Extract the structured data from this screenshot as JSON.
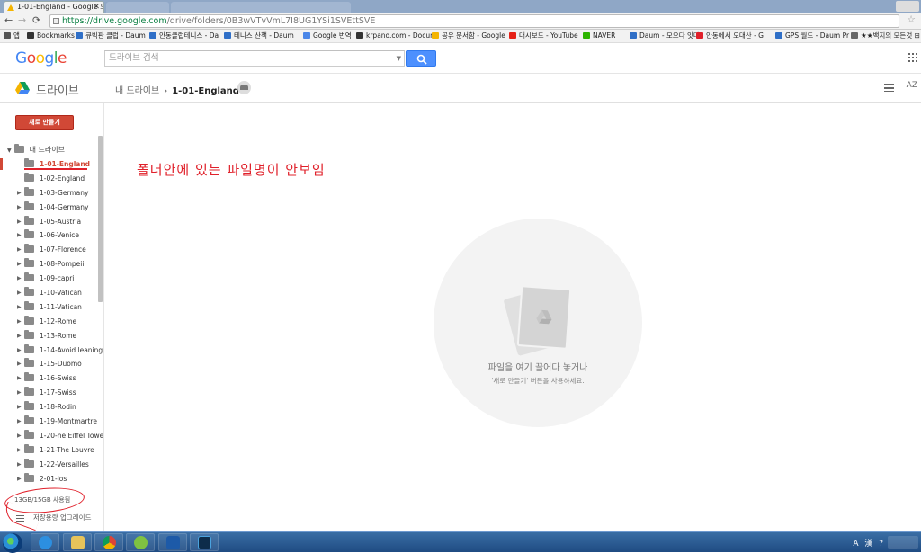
{
  "browser": {
    "tab_title": "1-01-England - Google 드",
    "url_scheme_host": "https://drive.google.com",
    "url_path": "/drive/folders/0B3wVTvVmL7I8UG1YSi1SVEttSVE"
  },
  "bookmarks": [
    {
      "label": "앱",
      "color": "#555"
    },
    {
      "label": "Bookmarks",
      "color": "#333"
    },
    {
      "label": "큐빅판 클럽 - Daum",
      "color": "#2f6fc7"
    },
    {
      "label": "안동클럽테니스 - Da",
      "color": "#2f6fc7"
    },
    {
      "label": "테니스 산책 - Daum",
      "color": "#2f6fc7"
    },
    {
      "label": "Google 번역",
      "color": "#4a86e8"
    },
    {
      "label": "krpano.com - Docum",
      "color": "#333"
    },
    {
      "label": "공유 문서함 - Google",
      "color": "#f4b400"
    },
    {
      "label": "대시보드 - YouTube",
      "color": "#e62117"
    },
    {
      "label": "NAVER",
      "color": "#2db400"
    },
    {
      "label": "Daum - 모으다 잇다",
      "color": "#2f6fc7"
    },
    {
      "label": "안동에서 오대산 - G",
      "color": "#e0202a"
    },
    {
      "label": "GPS 월드 - Daum Pr",
      "color": "#2f6fc7"
    },
    {
      "label": "★★백지의 모든것 ⊞",
      "color": "#666"
    }
  ],
  "header": {
    "logo": "Google",
    "search_placeholder": "드라이브 검색"
  },
  "drive": {
    "label": "드라이브",
    "breadcrumb_root": "내 드라이브",
    "breadcrumb_sep": "›",
    "breadcrumb_current": "1-01-England",
    "sort_label": "AZ"
  },
  "sidebar": {
    "new_button": "새로 만들기",
    "root_label": "내 드라이브",
    "folders": [
      {
        "name": "1-01-England",
        "selected": true,
        "expandable": false
      },
      {
        "name": "1-02-England",
        "expandable": false
      },
      {
        "name": "1-03-Germany",
        "expandable": true
      },
      {
        "name": "1-04-Germany",
        "expandable": true
      },
      {
        "name": "1-05-Austria",
        "expandable": true
      },
      {
        "name": "1-06-Venice",
        "expandable": true
      },
      {
        "name": "1-07-Florence",
        "expandable": true
      },
      {
        "name": "1-08-Pompeii",
        "expandable": true
      },
      {
        "name": "1-09-capri",
        "expandable": true
      },
      {
        "name": "1-10-Vatican",
        "expandable": true
      },
      {
        "name": "1-11-Vatican",
        "expandable": true
      },
      {
        "name": "1-12-Rome",
        "expandable": true
      },
      {
        "name": "1-13-Rome",
        "expandable": true
      },
      {
        "name": "1-14-Avoid leaning",
        "expandable": true
      },
      {
        "name": "1-15-Duomo",
        "expandable": true
      },
      {
        "name": "1-16-Swiss",
        "expandable": true
      },
      {
        "name": "1-17-Swiss",
        "expandable": true
      },
      {
        "name": "1-18-Rodin",
        "expandable": true
      },
      {
        "name": "1-19-Montmartre",
        "expandable": true
      },
      {
        "name": "1-20-he Eiffel Towe",
        "expandable": true
      },
      {
        "name": "1-21-The Louvre",
        "expandable": true
      },
      {
        "name": "1-22-Versailles",
        "expandable": true
      },
      {
        "name": "2-01-los",
        "expandable": true
      }
    ],
    "storage": "13GB/15GB 사용됨",
    "upgrade": "저장용량 업그레이드"
  },
  "main": {
    "annotation": "폴더안에  있는  파일명이  안보임",
    "drop_title": "파일을 여기 끌어다 놓거나",
    "drop_subtitle": "'새로 만들기' 버튼을 사용하세요."
  },
  "taskbar": {
    "tray_text": "A 漢 ?"
  }
}
